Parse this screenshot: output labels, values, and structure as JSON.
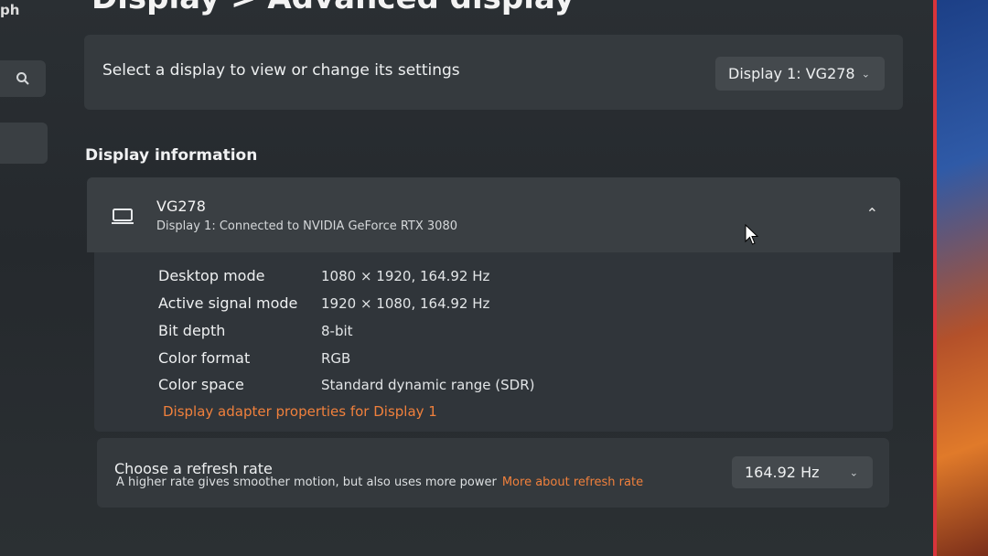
{
  "app": {
    "title_fragment": "ph"
  },
  "page": {
    "title": "Display  >  Advanced display"
  },
  "select_display": {
    "label": "Select a display to view or change its settings",
    "selected": "Display 1: VG278"
  },
  "display_information": {
    "section_title": "Display information",
    "name": "VG278",
    "subtitle": "Display 1: Connected to NVIDIA GeForce RTX 3080",
    "rows": [
      {
        "key": "Desktop mode",
        "value": "1080 × 1920, 164.92 Hz"
      },
      {
        "key": "Active signal mode",
        "value": "1920 × 1080, 164.92 Hz"
      },
      {
        "key": "Bit depth",
        "value": "8-bit"
      },
      {
        "key": "Color format",
        "value": "RGB"
      },
      {
        "key": "Color space",
        "value": "Standard dynamic range (SDR)"
      }
    ],
    "adapter_link": "Display adapter properties for Display 1"
  },
  "refresh_rate": {
    "title": "Choose a refresh rate",
    "description": "A higher rate gives smoother motion, but also uses more power",
    "more_link": "More about refresh rate",
    "selected": "164.92 Hz"
  },
  "icons": {
    "search": "search-icon",
    "monitor": "monitor-icon",
    "chevron_up": "chevron-up-icon",
    "chevron_down": "chevron-down-icon"
  },
  "colors": {
    "accent_link": "#f0803c",
    "card": "#353a3e",
    "background": "#2a2f33"
  }
}
